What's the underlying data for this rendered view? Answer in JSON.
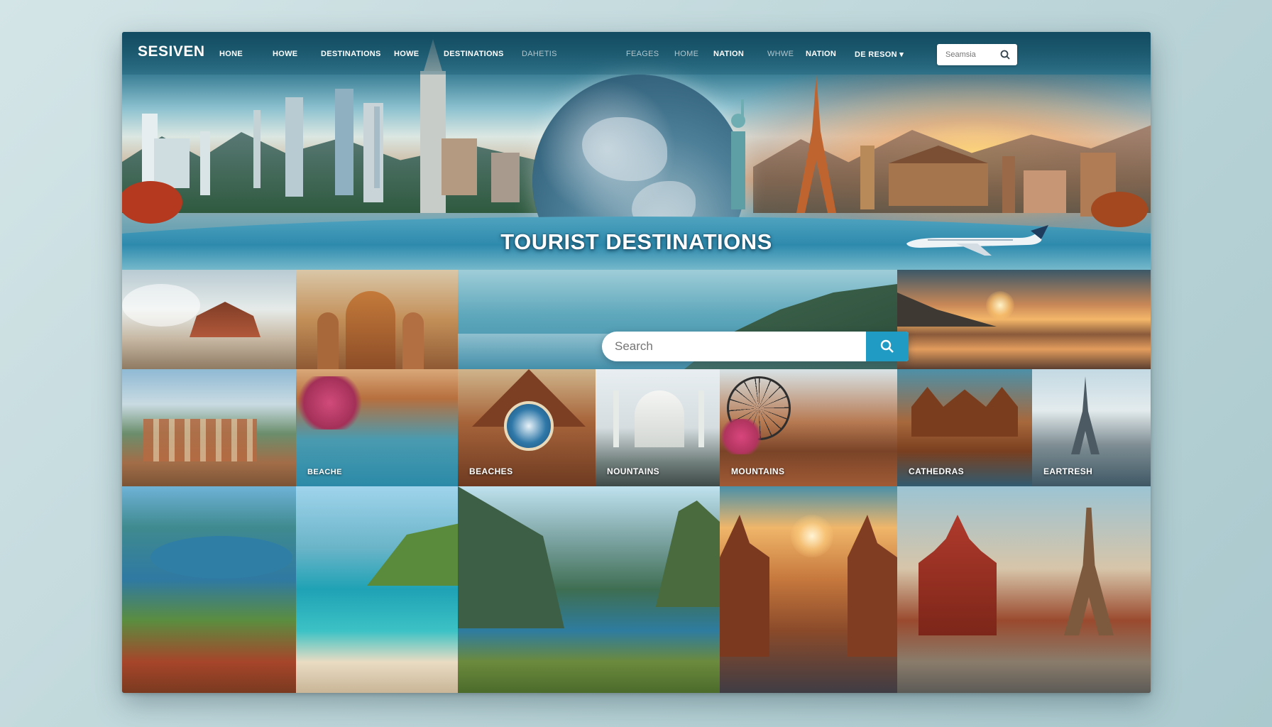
{
  "site": {
    "logo": "SESIVEN",
    "hero_title": "TOURIST DESTINATIONS"
  },
  "nav": {
    "items": [
      {
        "label": "HONE",
        "style": "bold"
      },
      {
        "label": "HOWE",
        "style": "bold"
      },
      {
        "label": "DESTINATIONS",
        "style": "bold"
      },
      {
        "label": "HOWE",
        "style": "bold"
      },
      {
        "label": "DESTINATIONS",
        "style": "bold"
      },
      {
        "label": "DAHETIS",
        "style": "dim"
      },
      {
        "label": "FEAGES",
        "style": "dim"
      },
      {
        "label": "HOME",
        "style": "dim"
      },
      {
        "label": "NATION",
        "style": "bold"
      },
      {
        "label": "WHWE",
        "style": "dim"
      },
      {
        "label": "NATION",
        "style": "bold"
      },
      {
        "label": "DE RESON ▾",
        "style": "bold"
      }
    ],
    "search_placeholder": "Seamsia"
  },
  "search": {
    "placeholder": "Search"
  },
  "tiles": {
    "cathedral_caption": "BEACHES",
    "beach_stage_caption": "BEACHE",
    "mosque_caption": "NOUNTAINS",
    "ferris_caption": "MOUNTAINS",
    "canal_caption": "CATHEDRAS",
    "paris_caption": "EARTRESH"
  },
  "colors": {
    "accent": "#1f9bc4",
    "frame_bg": "#174c5f",
    "page_bg": "#c3dadd"
  }
}
